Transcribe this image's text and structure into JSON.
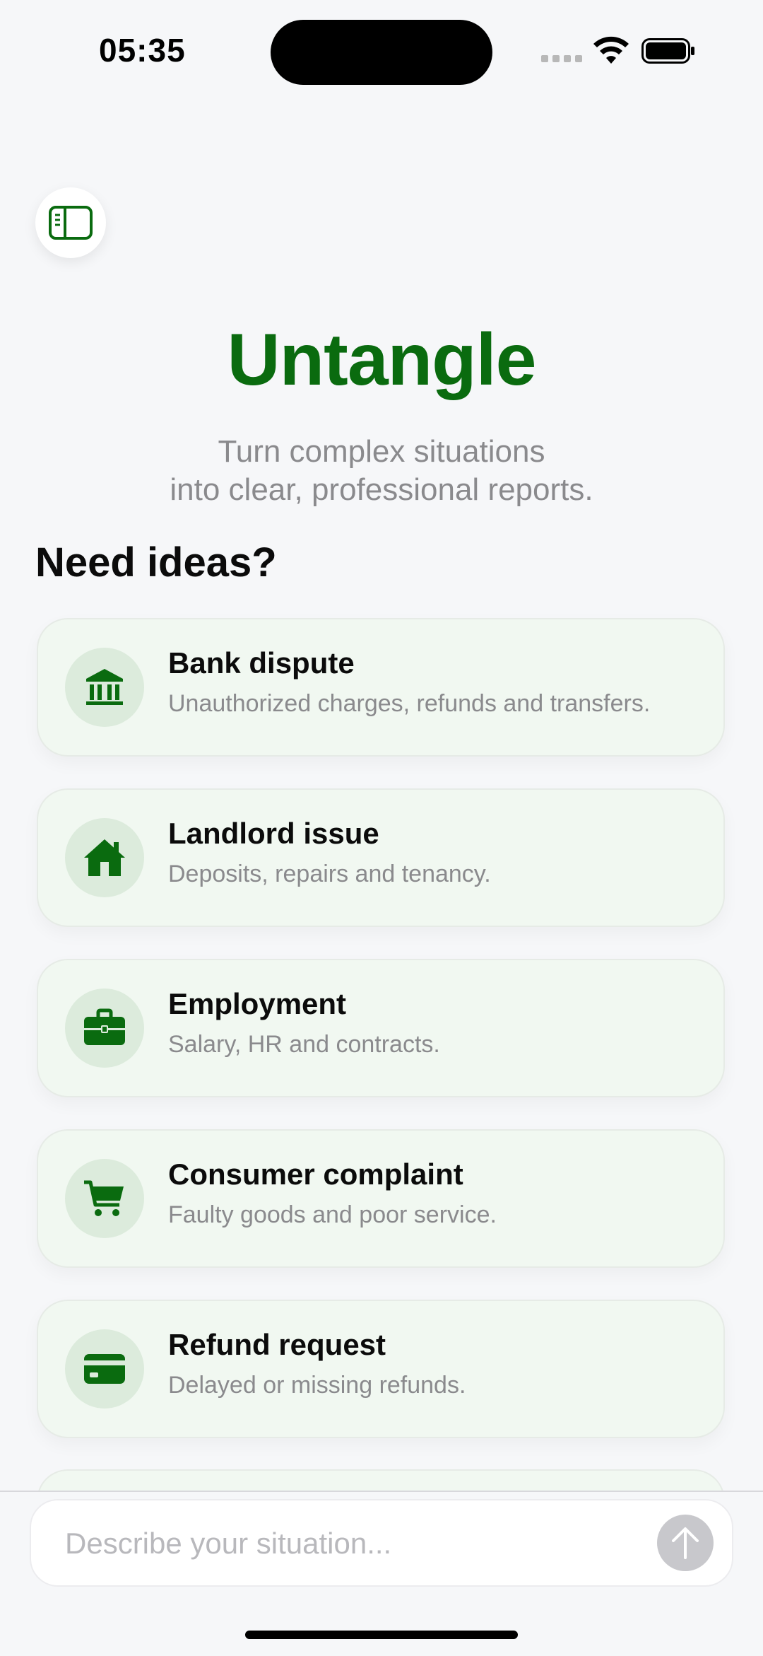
{
  "status_bar": {
    "time": "05:35",
    "icons": [
      "cellular-signal-icon",
      "wifi-icon",
      "battery-icon"
    ]
  },
  "header": {
    "sidebar_icon": "sidebar-toggle-icon"
  },
  "hero": {
    "title": "Untangle",
    "subtitle_line1": "Turn complex situations",
    "subtitle_line2": "into clear, professional reports."
  },
  "ideas": {
    "heading": "Need ideas?",
    "cards": [
      {
        "icon": "bank-icon",
        "title": "Bank dispute",
        "description": "Unauthorized charges, refunds and transfers."
      },
      {
        "icon": "house-icon",
        "title": "Landlord issue",
        "description": "Deposits, repairs and tenancy."
      },
      {
        "icon": "briefcase-icon",
        "title": "Employment",
        "description": "Salary, HR and contracts."
      },
      {
        "icon": "cart-icon",
        "title": "Consumer complaint",
        "description": "Faulty goods and poor service."
      },
      {
        "icon": "credit-card-icon",
        "title": "Refund request",
        "description": "Delayed or missing refunds."
      }
    ]
  },
  "composer": {
    "placeholder": "Describe your situation...",
    "value": "",
    "send_icon": "arrow-up-icon"
  },
  "colors": {
    "accent": "#0a6b0f",
    "card_background": "#f1f8f1",
    "icon_circle": "#dcebdc",
    "muted_text": "#8a8a8d",
    "send_disabled": "#c8c8cc"
  }
}
